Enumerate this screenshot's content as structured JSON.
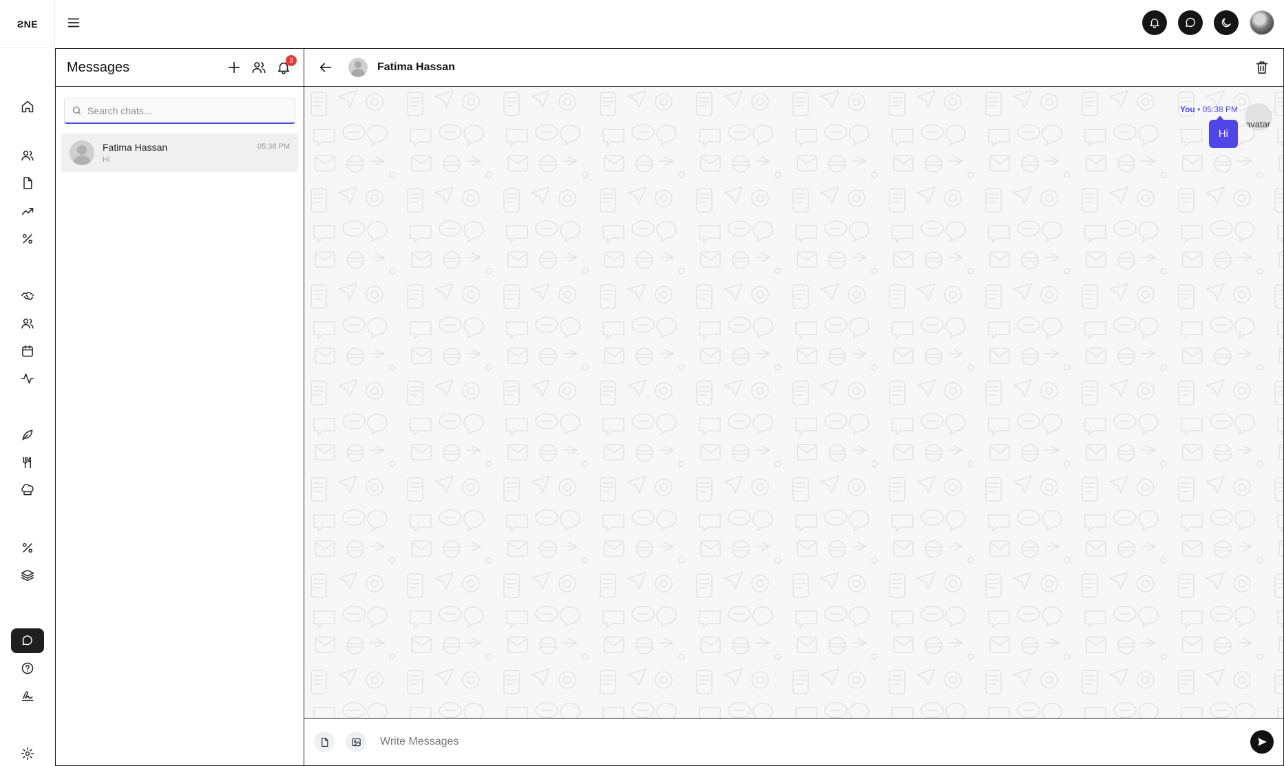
{
  "app": {
    "logo_text": "ƧNE"
  },
  "rail": {
    "items": [
      {
        "name": "home-icon"
      },
      {
        "name": "users-icon"
      },
      {
        "name": "document-icon"
      },
      {
        "name": "trending-icon"
      },
      {
        "name": "discount-icon"
      },
      {
        "name": "handshake-icon"
      },
      {
        "name": "team-icon"
      },
      {
        "name": "calendar-icon"
      },
      {
        "name": "activity-icon"
      },
      {
        "name": "leaf-icon"
      },
      {
        "name": "utensils-icon"
      },
      {
        "name": "chef-hat-icon"
      },
      {
        "name": "offer-icon"
      },
      {
        "name": "layers-icon"
      },
      {
        "name": "chat-icon",
        "active": true
      },
      {
        "name": "help-icon"
      },
      {
        "name": "signature-icon"
      },
      {
        "name": "settings-icon"
      }
    ]
  },
  "topbar": {
    "icons": [
      "bell-icon",
      "chat-bubble-icon",
      "moon-icon",
      "profile-avatar"
    ]
  },
  "messages_panel": {
    "title": "Messages",
    "notification_count": "3",
    "search_placeholder": "Search chats...",
    "chats": [
      {
        "name": "Fatima Hassan",
        "preview": "Hi",
        "time": "05:38 PM"
      }
    ]
  },
  "conversation": {
    "contact_name": "Fatima Hassan",
    "messages": [
      {
        "sender": "You",
        "separator": " • ",
        "time": "05:38 PM",
        "text": "Hi",
        "avatar_alt": "avatar"
      }
    ],
    "composer_placeholder": "Write Messages"
  },
  "colors": {
    "accent": "#4f46e5",
    "dark": "#151515",
    "badge": "#e53935",
    "chat_bg": "#f7f7f7"
  }
}
